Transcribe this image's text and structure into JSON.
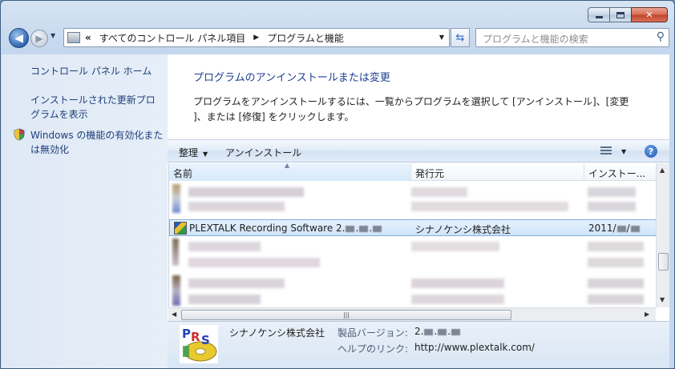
{
  "nav": {
    "breadcrumb_prefix": "«",
    "breadcrumb_items": [
      "すべてのコントロール パネル項目",
      "プログラムと機能"
    ],
    "search_placeholder": "プログラムと機能の検索"
  },
  "left_pane": {
    "links": [
      "コントロール パネル ホーム",
      "インストールされた更新プロ",
      "グラムを表示",
      "Windows の機能の有効化また",
      "は無効化"
    ]
  },
  "main": {
    "title": "プログラムのアンインストールまたは変更",
    "description_line1": "プログラムをアンインストールするには、一覧からプログラムを選択して [アンインストール]、[変更",
    "description_line2": "]、または [修復] をクリックします。"
  },
  "toolbar": {
    "organize_label": "整理",
    "uninstall_label": "アンインストール"
  },
  "list": {
    "columns": [
      "名前",
      "発行元",
      "インストー..."
    ],
    "selected_row": {
      "name": "PLEXTALK Recording Software 2.",
      "publisher": "シナノケンシ株式会社",
      "installed": "2011/"
    }
  },
  "details": {
    "publisher": "シナノケンシ株式会社",
    "version_label": "製品バージョン:",
    "version_value": "2.",
    "help_label": "ヘルプのリンク:",
    "help_value": "http://www.plextalk.com/"
  },
  "colors": {
    "link": "#1d3f79",
    "title": "#1f3f94",
    "selection": "#cfe4fa"
  }
}
